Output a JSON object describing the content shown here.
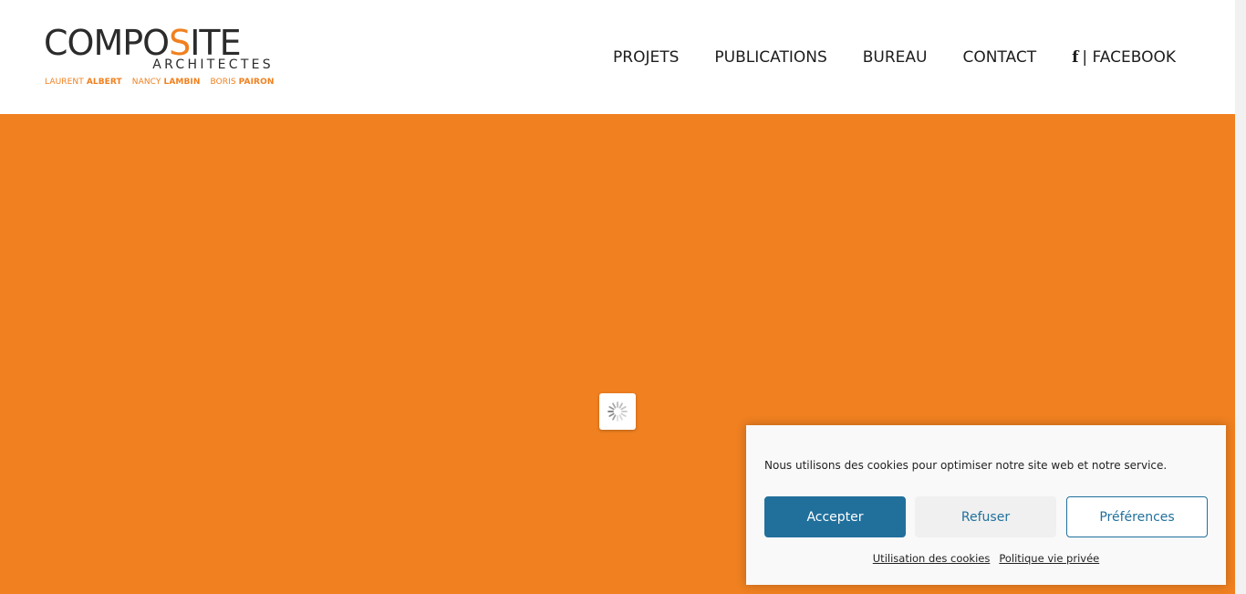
{
  "logo": {
    "main_before": "COMPO",
    "main_accent": "S",
    "main_after": "ITE",
    "sub": "ARCHITECTES",
    "names": [
      {
        "first": "LAURENT",
        "last": "ALBERT"
      },
      {
        "first": "NANCY",
        "last": "LAMBIN"
      },
      {
        "first": "BORIS",
        "last": "PAIRON"
      }
    ]
  },
  "nav": {
    "items": [
      {
        "label": "PROJETS"
      },
      {
        "label": "PUBLICATIONS"
      },
      {
        "label": "BUREAU"
      },
      {
        "label": "CONTACT"
      }
    ],
    "facebook": {
      "icon": "f",
      "label": "| FACEBOOK"
    }
  },
  "hero": {
    "color": "#f08020"
  },
  "cookie": {
    "message": "Nous utilisons des cookies pour optimiser notre site web et notre service.",
    "accept_label": "Accepter",
    "deny_label": "Refuser",
    "prefs_label": "Préférences",
    "links": [
      {
        "label": "Utilisation des cookies"
      },
      {
        "label": "Politique vie privée"
      }
    ]
  },
  "colors": {
    "accent": "#f08020",
    "button_primary": "#21709c",
    "text_dark": "#1d1d1d"
  }
}
